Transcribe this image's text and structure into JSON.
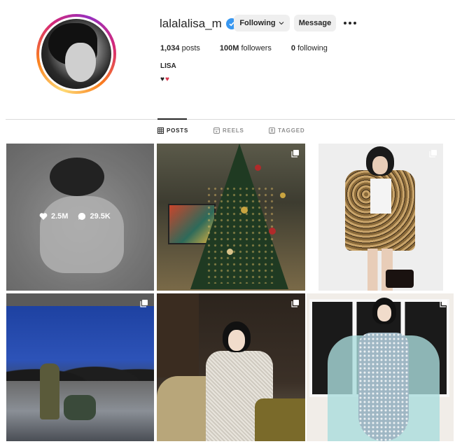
{
  "profile": {
    "username": "lalalalisa_m",
    "following_label": "Following",
    "message_label": "Message",
    "posts_count": "1,034",
    "posts_label": "posts",
    "followers_count": "100M",
    "followers_label": "followers",
    "following_count": "0",
    "following_stat_label": "following",
    "bio_name": "LISA",
    "bio_emoji_1": "♥",
    "bio_emoji_2": "♥"
  },
  "tabs": [
    {
      "label": "POSTS",
      "icon": "grid-icon",
      "active": true
    },
    {
      "label": "REELS",
      "icon": "reels-icon",
      "active": false
    },
    {
      "label": "TAGGED",
      "icon": "tagged-icon",
      "active": false
    }
  ],
  "grid": {
    "hover_post": {
      "likes": "2.5M",
      "comments": "29.5K"
    }
  },
  "colors": {
    "verified": "#3897f0",
    "button_bg": "#efefef",
    "heart_red": "#d9394f"
  }
}
